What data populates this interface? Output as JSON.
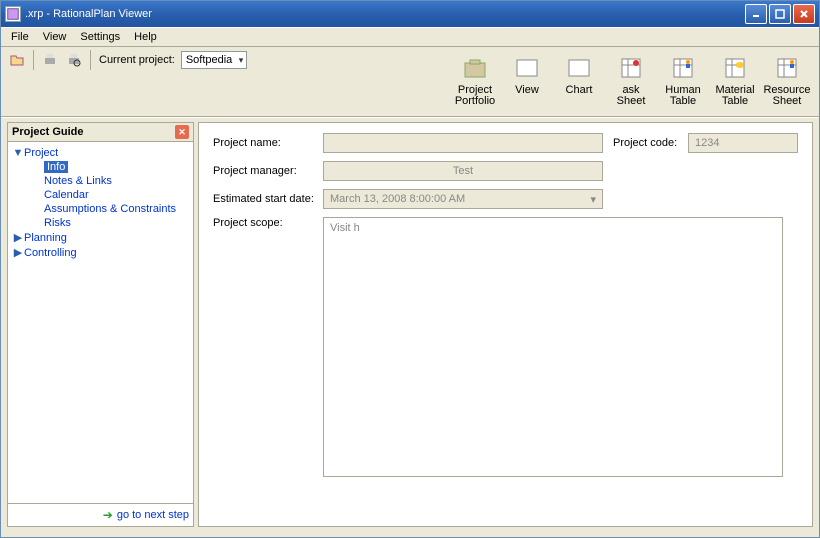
{
  "title": ".xrp - RationalPlan Viewer",
  "menus": {
    "file": "File",
    "view": "View",
    "settings": "Settings",
    "help": "Help"
  },
  "toolbar": {
    "current_project_label": "Current project:",
    "current_project_value": "Softpedia",
    "buttons": {
      "portfolio": "Project\nPortfolio",
      "view": "View",
      "chart": "Chart",
      "ask_sheet": "ask\nSheet",
      "human_table": "Human\nTable",
      "material_table": "Material\nTable",
      "resource_sheet": "Resource\nSheet"
    }
  },
  "guide": {
    "title": "Project Guide",
    "tree": {
      "project": "Project",
      "info": "Info",
      "notes": "Notes & Links",
      "calendar": "Calendar",
      "assumptions": "Assumptions & Constraints",
      "risks": "Risks",
      "planning": "Planning",
      "controlling": "Controlling"
    },
    "next_step": "go to next step"
  },
  "form": {
    "name_label": "Project name:",
    "name_value": "",
    "code_label": "Project code:",
    "code_value": "1234",
    "manager_label": "Project manager:",
    "manager_value": "Test",
    "date_label": "Estimated start date:",
    "date_value": "March 13, 2008 8:00:00 AM",
    "scope_label": "Project scope:",
    "scope_value": "Visit h"
  }
}
